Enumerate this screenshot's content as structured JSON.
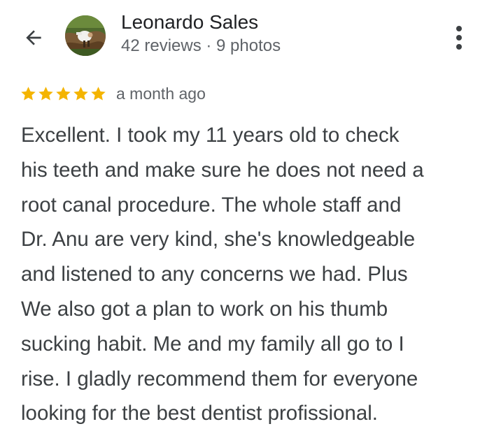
{
  "header": {
    "back_icon": "arrow-left-icon",
    "author_name": "Leonardo Sales",
    "author_meta": "42 reviews · 9 photos",
    "more_icon": "more-vert-icon"
  },
  "review": {
    "rating": 5,
    "rating_max": 5,
    "star_color": "#f4b400",
    "time_ago": "a month ago",
    "lines": [
      "Excellent. I took my 11 years old to check",
      "his teeth and make sure he does not need a",
      "root canal procedure. The whole staff and",
      "Dr. Anu are very kind, she's knowledgeable",
      "and listened to any concerns we had. Plus",
      "We also got a plan to work on his thumb",
      "sucking habit. Me and my family all go to I",
      "rise. I gladly recommend them for everyone",
      "looking for the best dentist profissional."
    ]
  },
  "colors": {
    "text_primary": "#202124",
    "text_secondary": "#5f6368",
    "body_text": "#3c4043"
  }
}
